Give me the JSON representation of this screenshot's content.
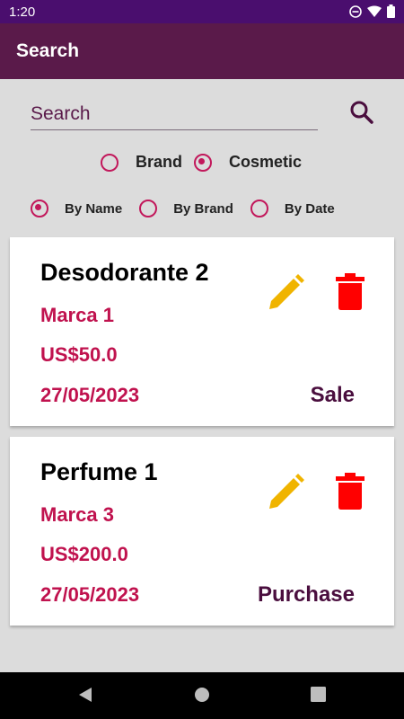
{
  "status_bar": {
    "time": "1:20"
  },
  "app_bar": {
    "title": "Search"
  },
  "search": {
    "placeholder": "Search"
  },
  "category_filter": {
    "options": [
      "Brand",
      "Cosmetic"
    ],
    "selected": "Cosmetic"
  },
  "sort_filter": {
    "options": [
      "By Name",
      "By Brand",
      "By Date"
    ],
    "selected": "By Name"
  },
  "items": [
    {
      "name": "Desodorante 2",
      "brand": "Marca 1",
      "price": "US$50.0",
      "date": "27/05/2023",
      "type": "Sale"
    },
    {
      "name": "Perfume 1",
      "brand": "Marca 3",
      "price": "US$200.0",
      "date": "27/05/2023",
      "type": "Purchase"
    }
  ],
  "colors": {
    "status_bar": "#4a0e6e",
    "app_bar": "#5a1a4a",
    "accent": "#c2185b",
    "edit_icon": "#f0b400",
    "delete_icon": "#ff0000"
  },
  "icons": [
    "dnd-icon",
    "wifi-icon",
    "battery-icon",
    "search-icon",
    "edit-icon",
    "delete-icon",
    "back-icon",
    "home-icon",
    "recents-icon"
  ]
}
